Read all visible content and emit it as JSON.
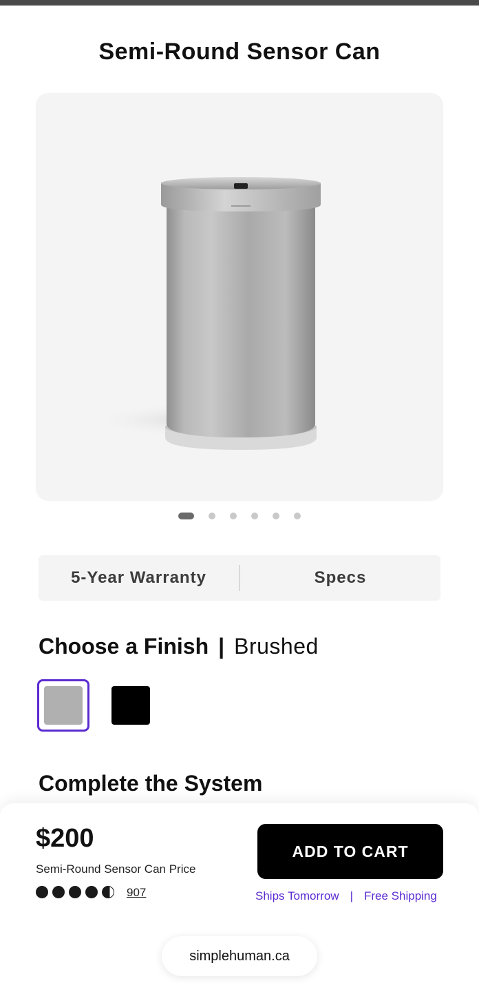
{
  "product": {
    "title": "Semi-Round Sensor Can",
    "image_alt": "Brushed stainless steel semi-round sensor trash can",
    "gallery": {
      "count": 6,
      "active_index": 0
    }
  },
  "tabs": [
    {
      "label": "5-Year Warranty"
    },
    {
      "label": "Specs"
    }
  ],
  "finish": {
    "label": "Choose a Finish",
    "separator": "|",
    "selected": "Brushed",
    "options": [
      {
        "name": "Brushed",
        "color": "#b0b0b0",
        "selected": true
      },
      {
        "name": "Black",
        "color": "#000000",
        "selected": false
      }
    ],
    "accent_color": "#5b2bd1"
  },
  "complete_system": {
    "heading": "Complete the System"
  },
  "purchase": {
    "price": "$200",
    "price_label": "Semi-Round Sensor Can Price",
    "rating": 4.6,
    "review_count": "907",
    "cta_label": "ADD TO CART",
    "shipping_left": "Ships Tomorrow",
    "shipping_sep": "|",
    "shipping_right": "Free Shipping"
  },
  "browser": {
    "url": "simplehuman.ca"
  }
}
